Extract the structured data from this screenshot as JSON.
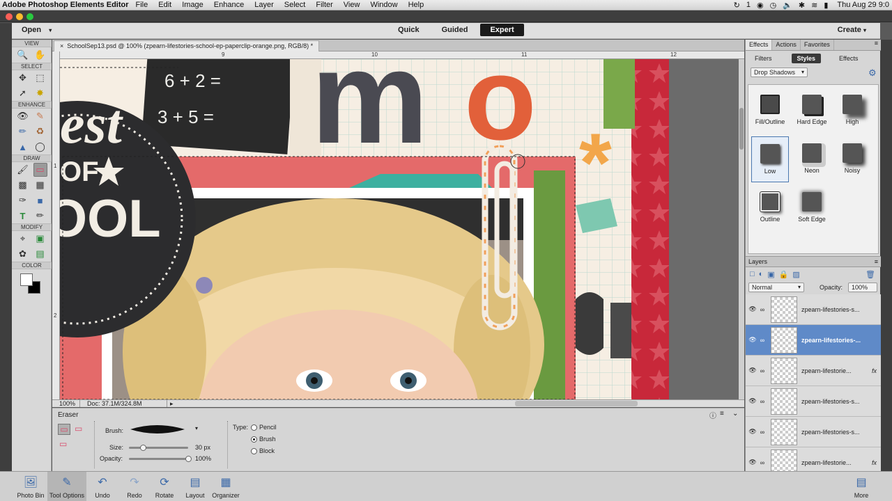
{
  "menubar": {
    "app_name": "Adobe Photoshop Elements Editor",
    "items": [
      "File",
      "Edit",
      "Image",
      "Enhance",
      "Layer",
      "Select",
      "Filter",
      "View",
      "Window",
      "Help"
    ],
    "status_badge": "1",
    "clock": "Thu Aug 29  9:0"
  },
  "modebar": {
    "open_label": "Open",
    "tabs": [
      "Quick",
      "Guided",
      "Expert"
    ],
    "active_tab": "Expert",
    "create_label": "Create"
  },
  "toolbox": {
    "sections": [
      "VIEW",
      "SELECT",
      "ENHANCE",
      "DRAW",
      "MODIFY",
      "COLOR"
    ]
  },
  "document": {
    "tab_title": "SchoolSep13.psd @ 100% (zpearn-lifestories-school-ep-paperclip-orange.png, RGB/8) *",
    "ruler_top_labels": [
      "9",
      "10",
      "11",
      "12"
    ],
    "ruler_left_labels": [
      "1",
      "2"
    ],
    "art_text": {
      "math_1": "6 + 2 =",
      "math_2": "3 + 5 =",
      "letter_m": "m",
      "letter_o": "o",
      "asterisk": "*",
      "badge_top": "est",
      "badge_mid": "OF",
      "badge_bottom": "OOL"
    }
  },
  "statusbar": {
    "zoom": "100%",
    "doc_info": "Doc: 37.1M/324.8M"
  },
  "tool_options": {
    "title": "Eraser",
    "brush_label": "Brush:",
    "size_label": "Size:",
    "size_value": "30 px",
    "size_fraction": 0.24,
    "opacity_label": "Opacity:",
    "opacity_value": "100%",
    "opacity_fraction": 1.0,
    "type_label": "Type:",
    "types": [
      "Pencil",
      "Brush",
      "Block"
    ],
    "selected_type": "Brush"
  },
  "effects_panel": {
    "tabs": [
      "Effects",
      "Actions",
      "Favorites"
    ],
    "sub_tabs": [
      "Filters",
      "Styles",
      "Effects"
    ],
    "active_sub_tab": "Styles",
    "dropdown_value": "Drop Shadows",
    "styles": [
      "Fill/Outline",
      "Hard Edge",
      "High",
      "Low",
      "Neon",
      "Noisy",
      "Outline",
      "Soft Edge"
    ],
    "selected_style": "Low"
  },
  "layers_panel": {
    "title": "Layers",
    "blend_mode": "Normal",
    "opacity_label": "Opacity:",
    "opacity_value": "100%",
    "layers": [
      {
        "name": "zpearn-lifestories-s...",
        "fx": false,
        "selected": false
      },
      {
        "name": "zpearn-lifestories-...",
        "fx": false,
        "selected": true
      },
      {
        "name": "zpearn-lifestorie...",
        "fx": true,
        "selected": false
      },
      {
        "name": "zpearn-lifestories-s...",
        "fx": false,
        "selected": false
      },
      {
        "name": "zpearn-lifestories-s...",
        "fx": false,
        "selected": false
      },
      {
        "name": "zpearn-lifestorie...",
        "fx": true,
        "selected": false
      }
    ],
    "fx_label": "fx"
  },
  "taskbar": {
    "items": [
      "Photo Bin",
      "Tool Options",
      "Undo",
      "Redo",
      "Rotate",
      "Layout",
      "Organizer"
    ],
    "more_label": "More"
  }
}
